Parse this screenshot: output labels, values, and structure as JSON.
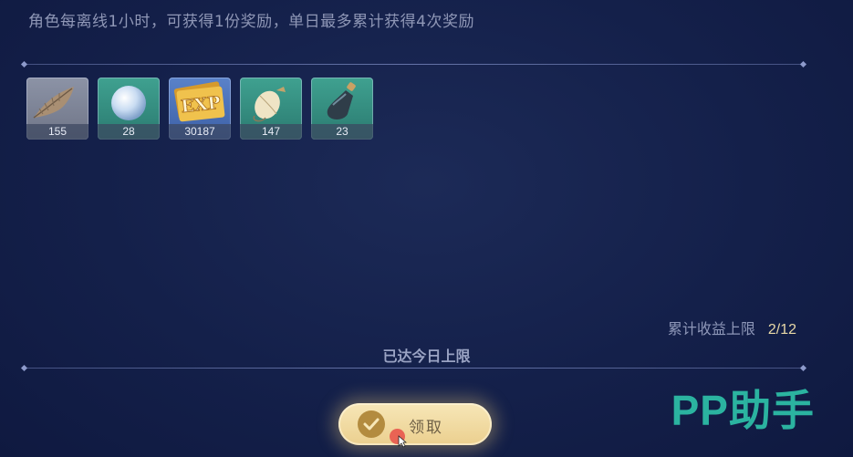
{
  "description": "角色每离线1小时，可获得1份奖励，单日最多累计获得4次奖励",
  "rewards": [
    {
      "icon": "feather-icon",
      "count": "155",
      "rarity": "gray"
    },
    {
      "icon": "pearl-icon",
      "count": "28",
      "rarity": "green"
    },
    {
      "icon": "exp-ticket-icon",
      "count": "30187",
      "rarity": "blue"
    },
    {
      "icon": "pouch-icon",
      "count": "147",
      "rarity": "green"
    },
    {
      "icon": "potion-bottle-icon",
      "count": "23",
      "rarity": "green"
    }
  ],
  "limit": {
    "label": "累计收益上限",
    "value": "2/12"
  },
  "status": "已达今日上限",
  "claim_button": {
    "label": "领取"
  },
  "watermark": "PP助手",
  "colors": {
    "background": "#14204a",
    "claim_button": "#f2dca2",
    "limit_value": "#e8d9a7",
    "watermark": "#2bb3a0"
  }
}
